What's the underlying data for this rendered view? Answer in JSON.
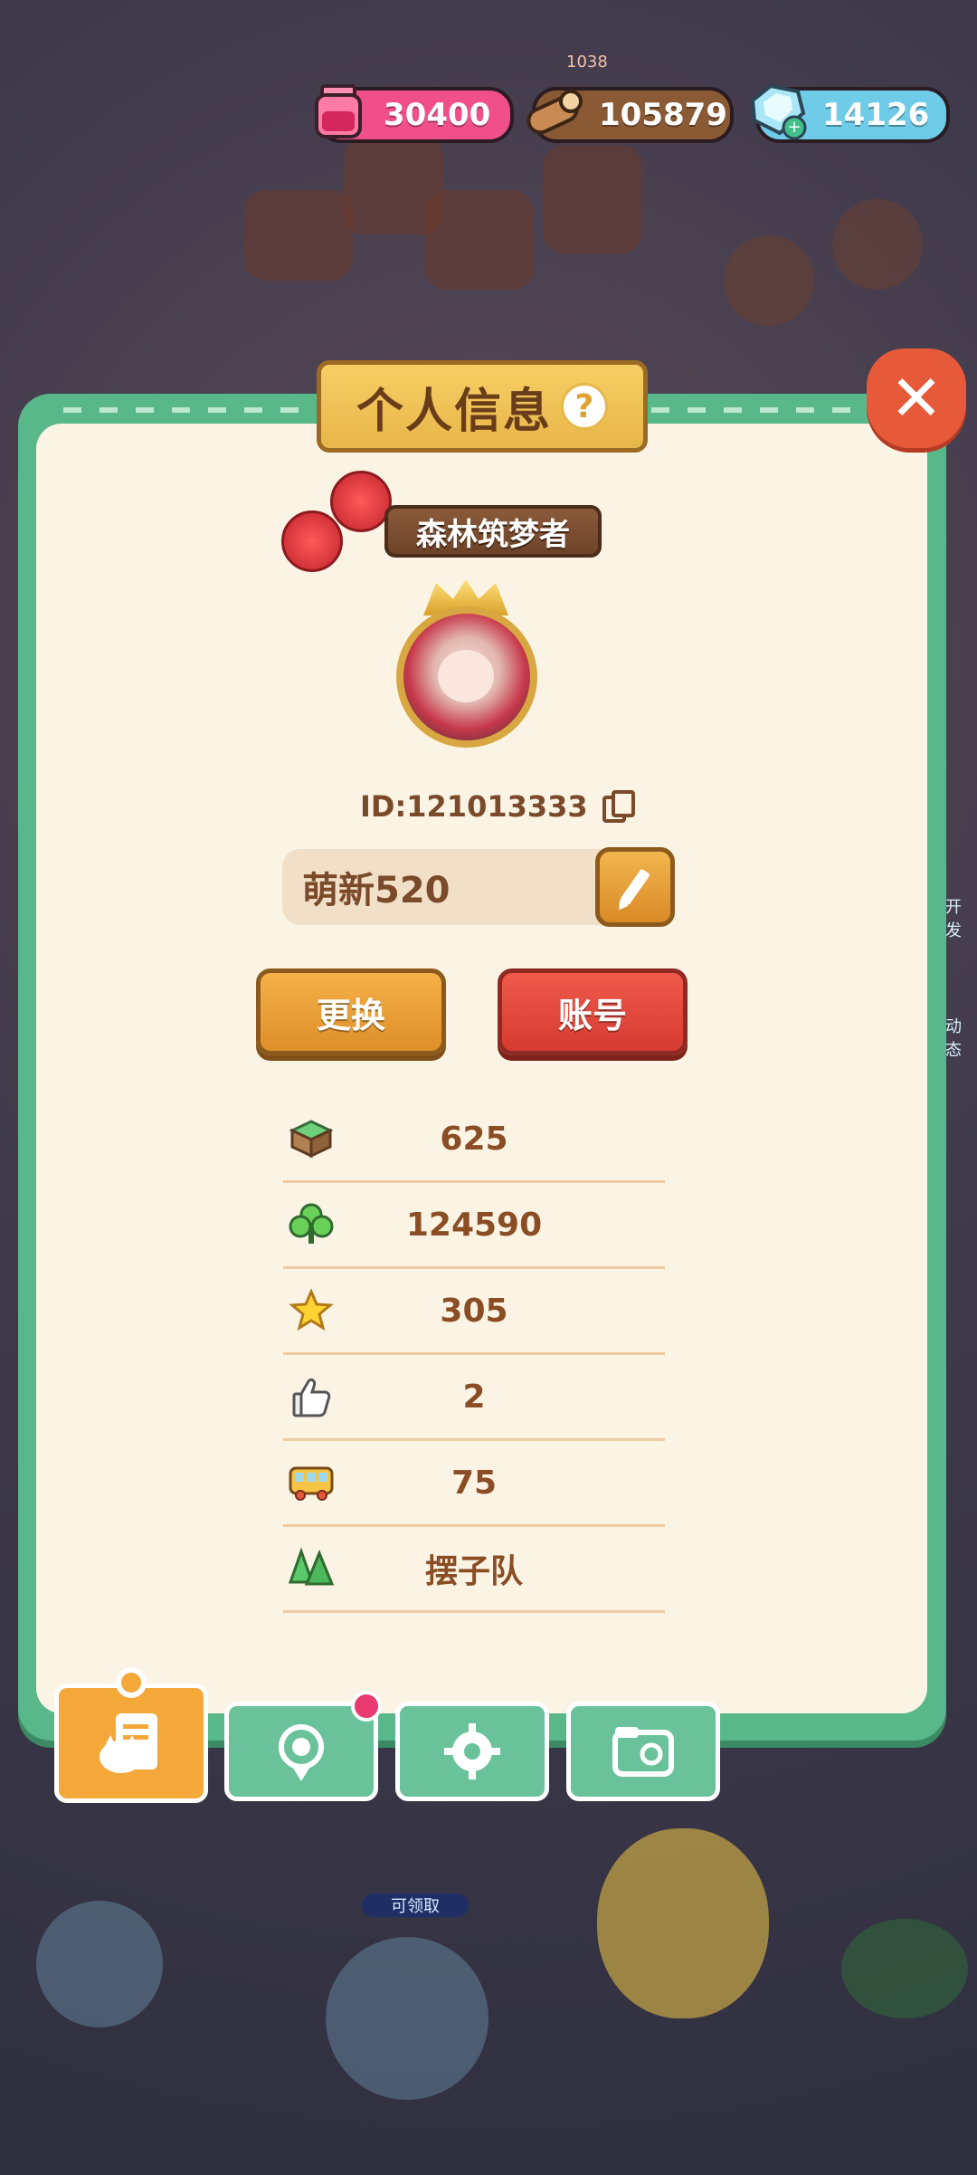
{
  "currencies": {
    "ink": "30400",
    "wood": "105879",
    "gem": "14126"
  },
  "scene": {
    "top_label": "1038",
    "hint_label": "可领取",
    "side_label_1": "开发",
    "side_label_2": "动态"
  },
  "modal": {
    "title": "个人信息",
    "help_symbol": "?",
    "close_symbol": "✕",
    "badge_title": "森林筑梦者",
    "player_id": "ID:121013333",
    "nickname": "萌新520",
    "change_button": "更换",
    "account_button": "账号"
  },
  "stats": [
    {
      "icon": "grass-block-icon",
      "value": "625"
    },
    {
      "icon": "clover-icon",
      "value": "124590"
    },
    {
      "icon": "star-icon",
      "value": "305"
    },
    {
      "icon": "thumbs-up-icon",
      "value": "2"
    },
    {
      "icon": "bus-icon",
      "value": "75"
    },
    {
      "icon": "tree-group-icon",
      "value": "摆子队"
    }
  ],
  "tabs": [
    {
      "name": "profile-tab",
      "icon": "cat-note-icon",
      "active": true
    },
    {
      "name": "achievements-tab",
      "icon": "badge-icon",
      "active": false,
      "notification": true
    },
    {
      "name": "settings-tab",
      "icon": "gear-icon",
      "active": false
    },
    {
      "name": "album-tab",
      "icon": "folder-photo-icon",
      "active": false
    }
  ],
  "colors": {
    "panel_green": "#58b88a",
    "panel_cream": "#fbf4e4",
    "title_gold": "#e8b64a",
    "button_orange": "#dd8f2a",
    "button_red": "#d63a31"
  }
}
